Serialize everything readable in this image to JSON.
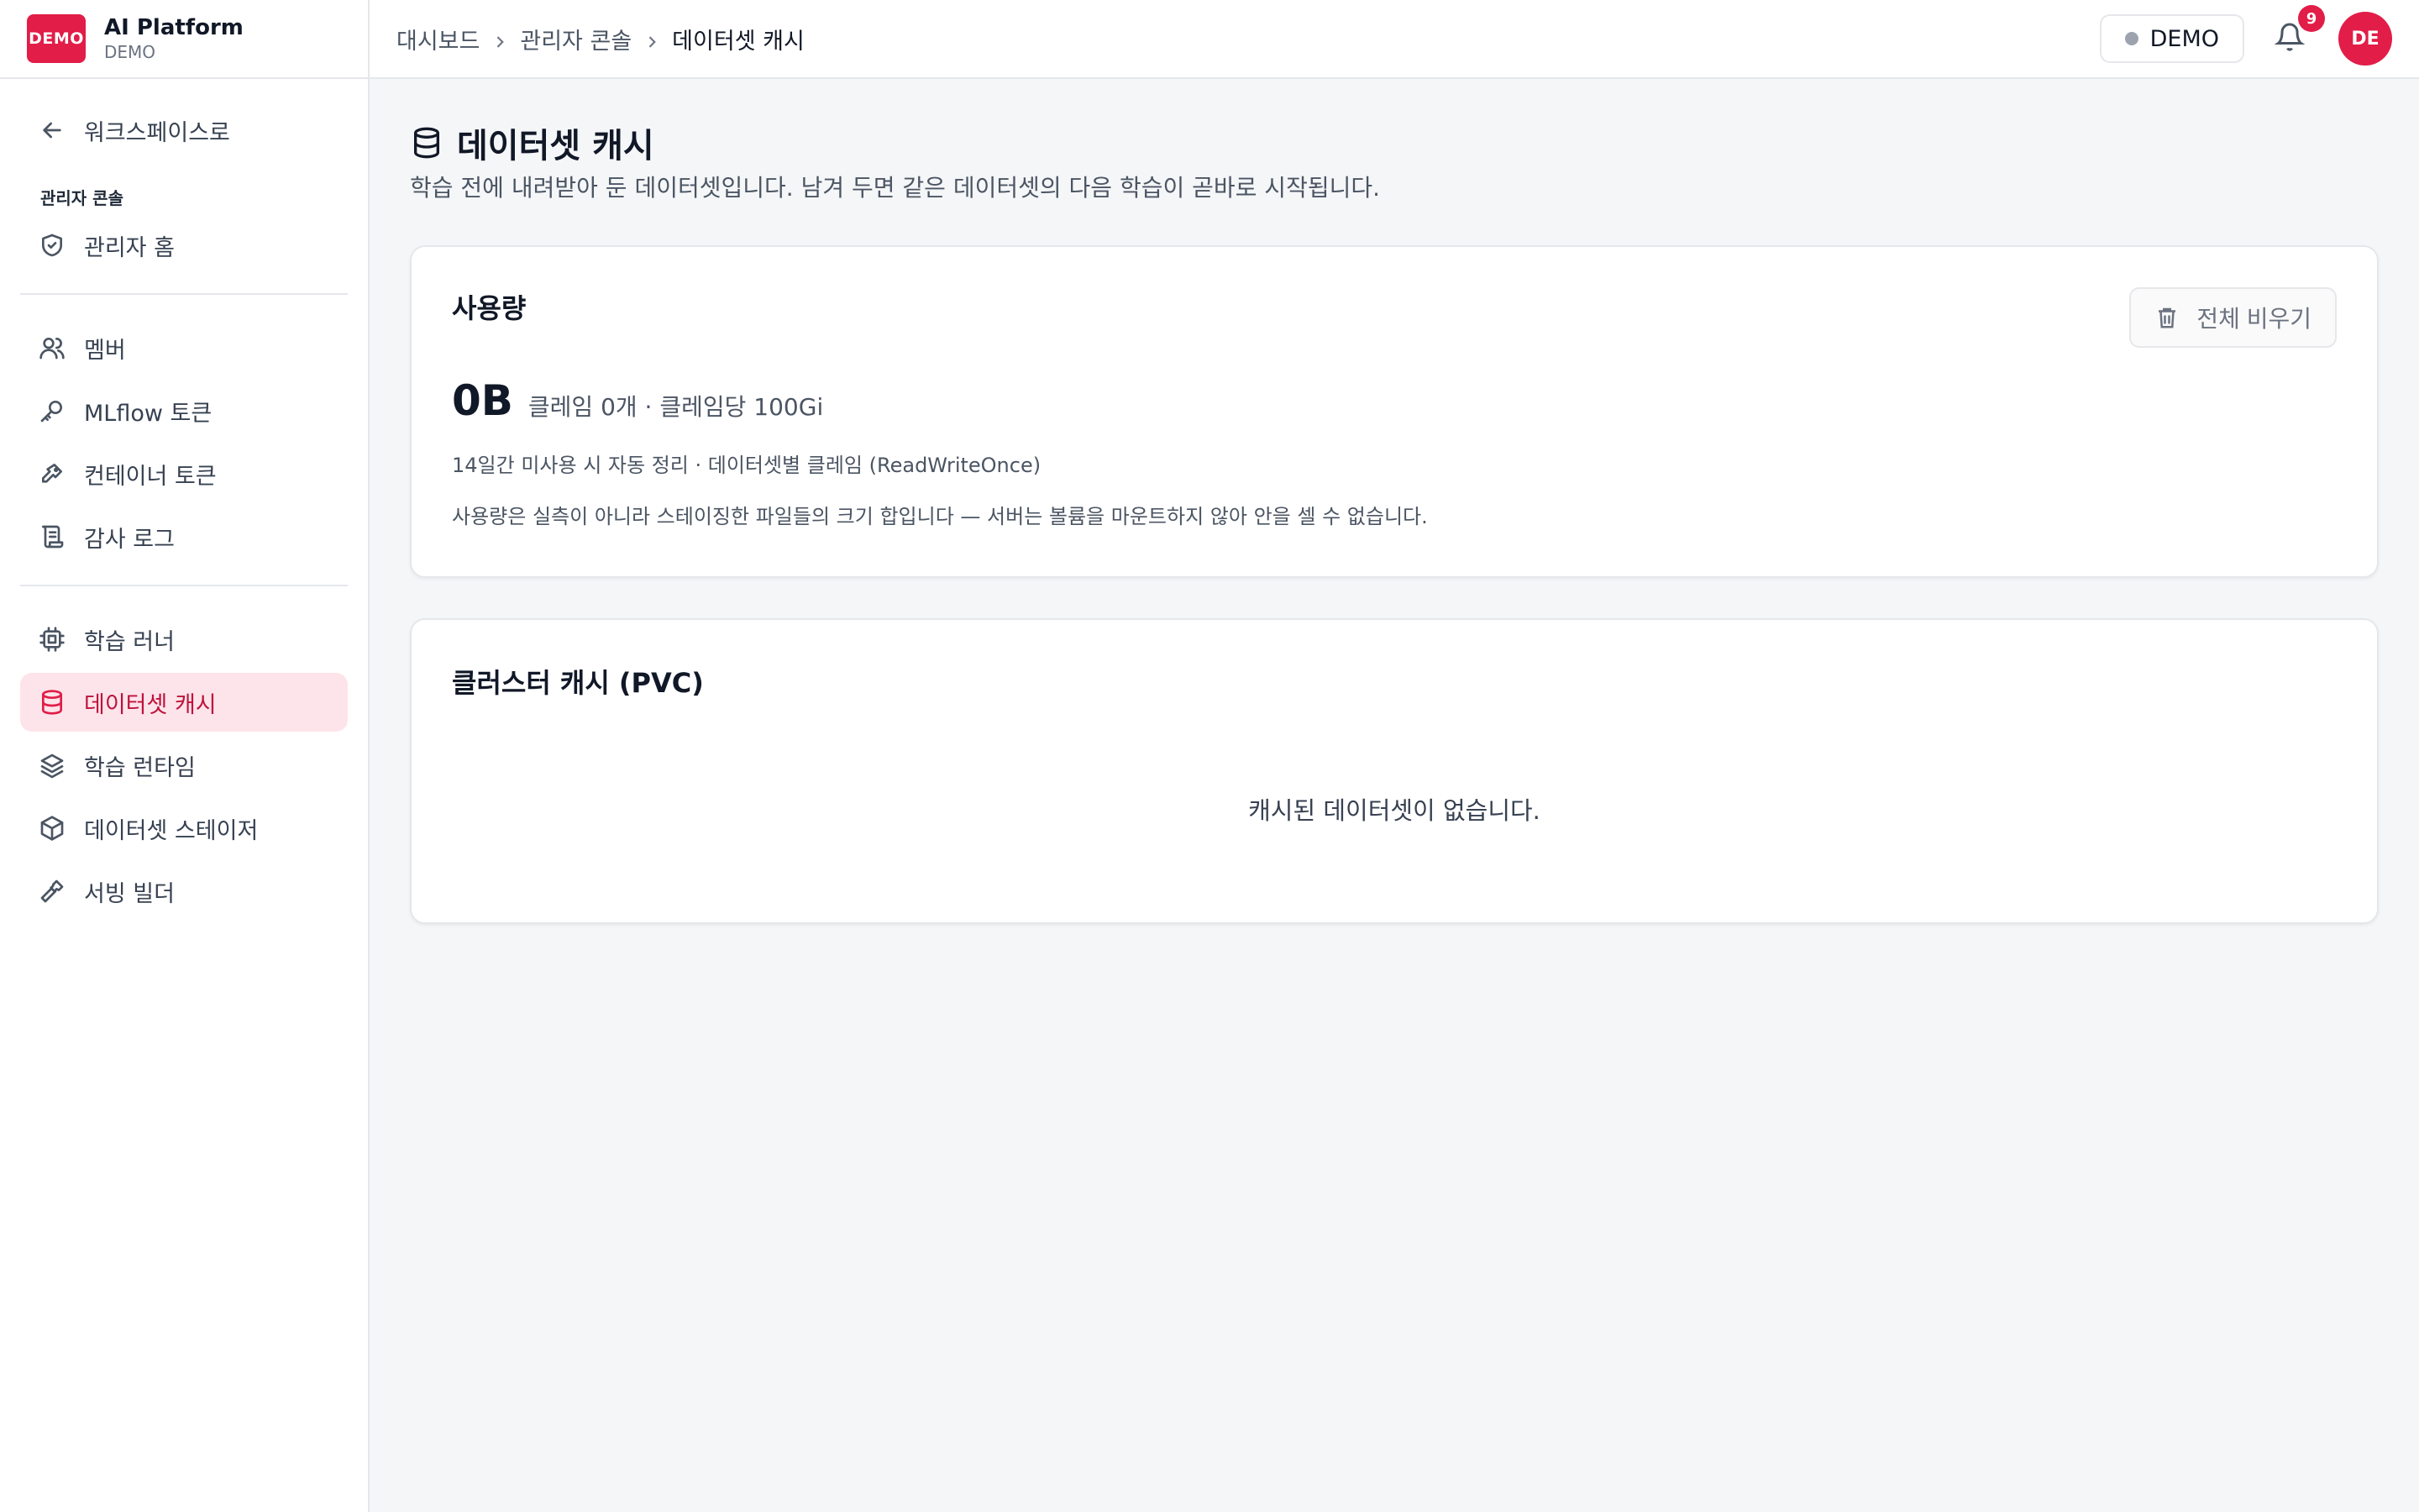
{
  "brand": {
    "logo_text": "DEMO",
    "name": "AI Platform",
    "sub": "DEMO"
  },
  "sidebar": {
    "back_label": "워크스페이스로",
    "section_label": "관리자 콘솔",
    "admin_home": "관리자 홈",
    "members": "멤버",
    "mlflow_token": "MLflow 토큰",
    "container_token": "컨테이너 토큰",
    "audit_log": "감사 로그",
    "training_runner": "학습 러너",
    "dataset_cache": "데이터셋 캐시",
    "training_runtime": "학습 런타임",
    "dataset_stager": "데이터셋 스테이저",
    "serving_builder": "서빙 빌더"
  },
  "header": {
    "breadcrumb": [
      "대시보드",
      "관리자 콘솔",
      "데이터셋 캐시"
    ],
    "env_label": "DEMO",
    "notification_count": "9",
    "avatar_initials": "DE"
  },
  "main": {
    "title": "데이터셋 캐시",
    "description": "학습 전에 내려받아 둔 데이터셋입니다. 남겨 두면 같은 데이터셋의 다음 학습이 곧바로 시작됩니다.",
    "usage": {
      "title": "사용량",
      "clear_button": "전체 비우기",
      "value": "0B",
      "meta": "클레임 0개 · 클레임당 100Gi",
      "note1": "14일간 미사용 시 자동 정리 · 데이터셋별 클레임 (ReadWriteOnce)",
      "note2": "사용량은 실측이 아니라 스테이징한 파일들의 크기 합입니다 — 서버는 볼륨을 마운트하지 않아 안을 셀 수 없습니다."
    },
    "cluster": {
      "title": "클러스터 캐시 (PVC)",
      "empty": "캐시된 데이터셋이 없습니다."
    }
  },
  "colors": {
    "accent": "#e11d48",
    "active_bg": "#fde4ea"
  }
}
